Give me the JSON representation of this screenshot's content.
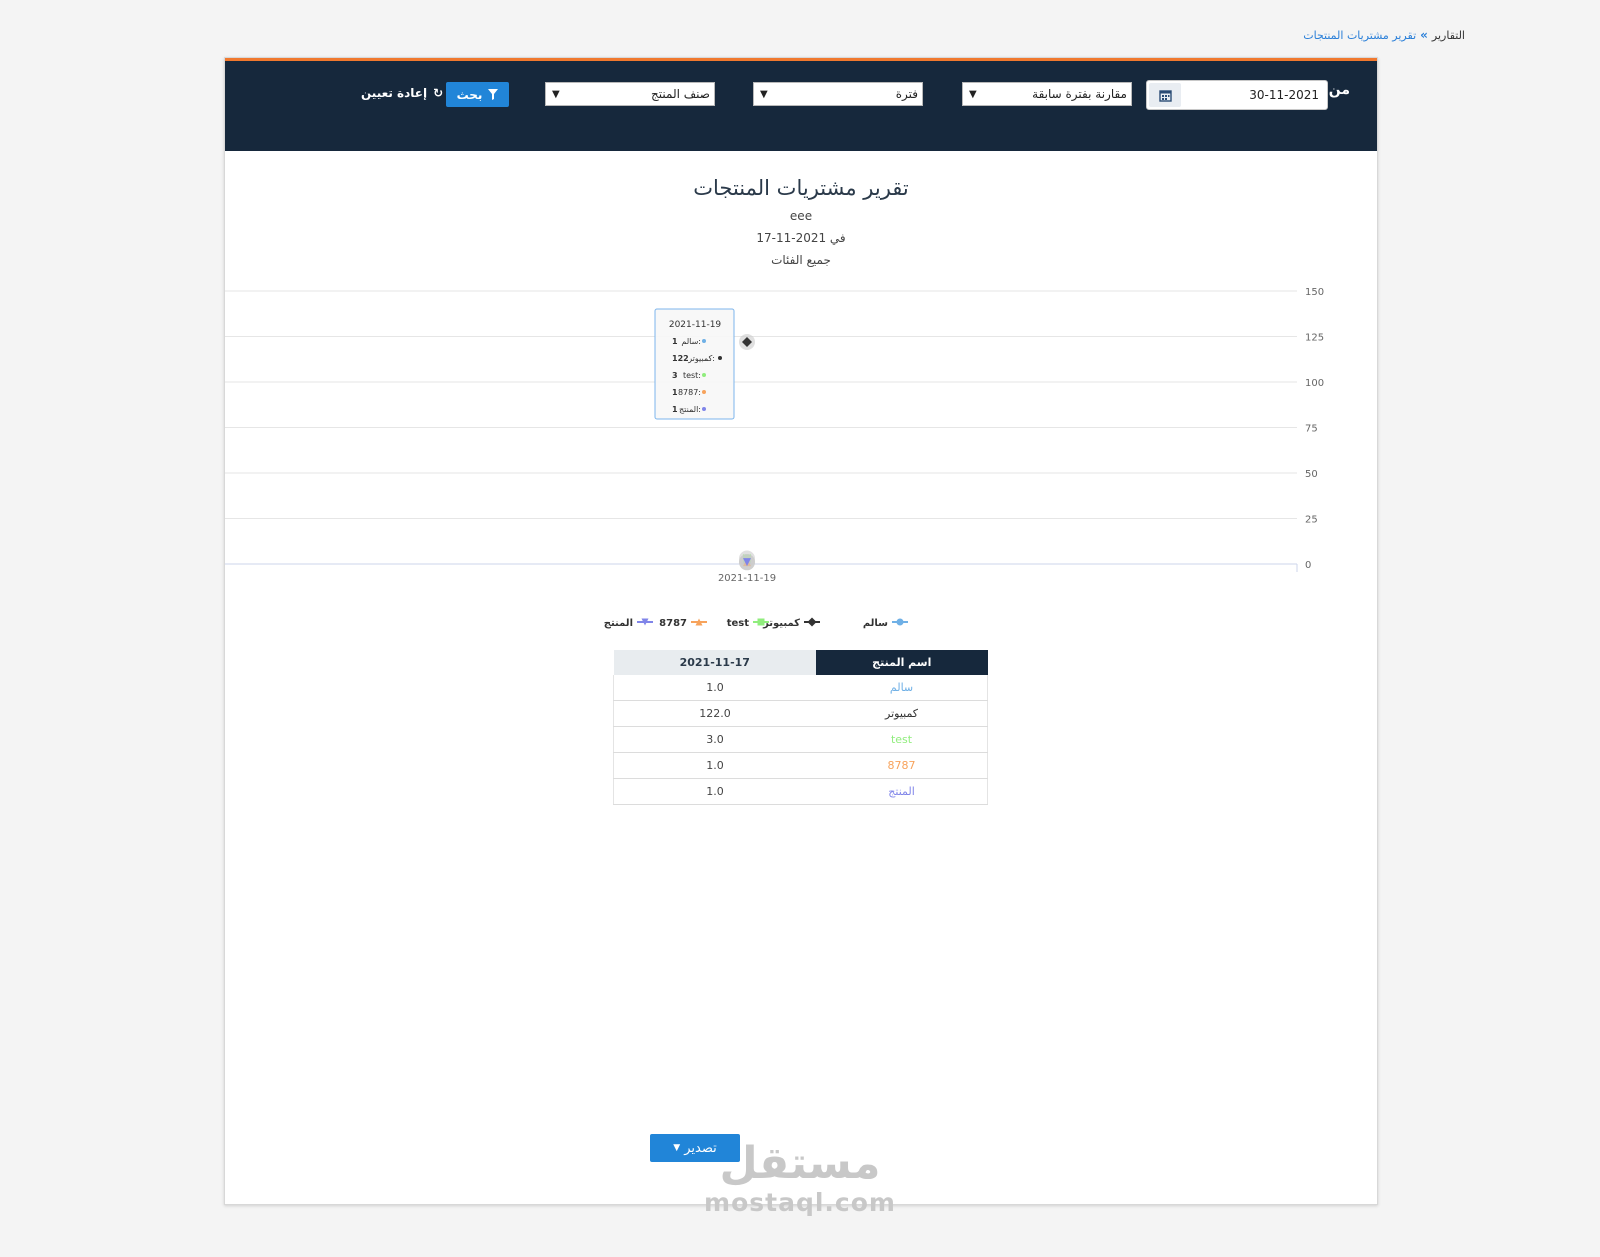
{
  "breadcrumb": {
    "root": "التقارير",
    "current": "تقرير مشتريات المنتجات"
  },
  "filters": {
    "from_label": "من",
    "date_value": "30-11-2021",
    "compare_select": "مقارنة بفترة سابقة",
    "period_select": "فترة",
    "category_select": "صنف المنتج",
    "search_label": "بحث",
    "reset_label": "إعادة تعيين"
  },
  "report": {
    "title": "تقرير مشتريات المنتجات",
    "subtitle": "eee",
    "date_line": "في 2021-11-17",
    "category_line": "جميع الفئات"
  },
  "chart_data": {
    "type": "line",
    "x": [
      "2021-11-19"
    ],
    "ylim": [
      0,
      150
    ],
    "yticks": [
      "0",
      "25",
      "50",
      "75",
      "100",
      "125",
      "150"
    ],
    "grid": true,
    "legend_position": "bottom",
    "series": [
      {
        "name": "سالم",
        "values": [
          1
        ],
        "color": "#6fb0e6",
        "marker": "circle"
      },
      {
        "name": "كمبيوتر",
        "values": [
          122
        ],
        "color": "#333333",
        "marker": "diamond"
      },
      {
        "name": "test",
        "values": [
          3
        ],
        "color": "#90ed7d",
        "marker": "square"
      },
      {
        "name": "8787",
        "values": [
          1
        ],
        "color": "#f7a35c",
        "marker": "triangle"
      },
      {
        "name": "المنتج",
        "values": [
          1
        ],
        "color": "#8085e9",
        "marker": "triangle-down"
      }
    ],
    "tooltip": {
      "header": "2021-11-19",
      "rows": [
        {
          "label": "سالم:",
          "value": "1"
        },
        {
          "label": "كمبيوتر:",
          "value": "122"
        },
        {
          "label": "test:",
          "value": "3"
        },
        {
          "label": "8787:",
          "value": "1"
        },
        {
          "label": "المنتج:",
          "value": "1"
        }
      ]
    }
  },
  "table": {
    "headers": {
      "name": "اسم المنتج",
      "date": "2021-11-17"
    },
    "rows": [
      {
        "name": "سالم",
        "value": "1.0",
        "color": "#6fb0e6"
      },
      {
        "name": "كمبيوتر",
        "value": "122.0",
        "color": "#333333"
      },
      {
        "name": "test",
        "value": "3.0",
        "color": "#90ed7d"
      },
      {
        "name": "8787",
        "value": "1.0",
        "color": "#f7a35c"
      },
      {
        "name": "المنتج",
        "value": "1.0",
        "color": "#8085e9"
      }
    ]
  },
  "export_label": "تصدير",
  "watermark": {
    "arabic": "مستقل",
    "latin": "mostaql.com"
  }
}
